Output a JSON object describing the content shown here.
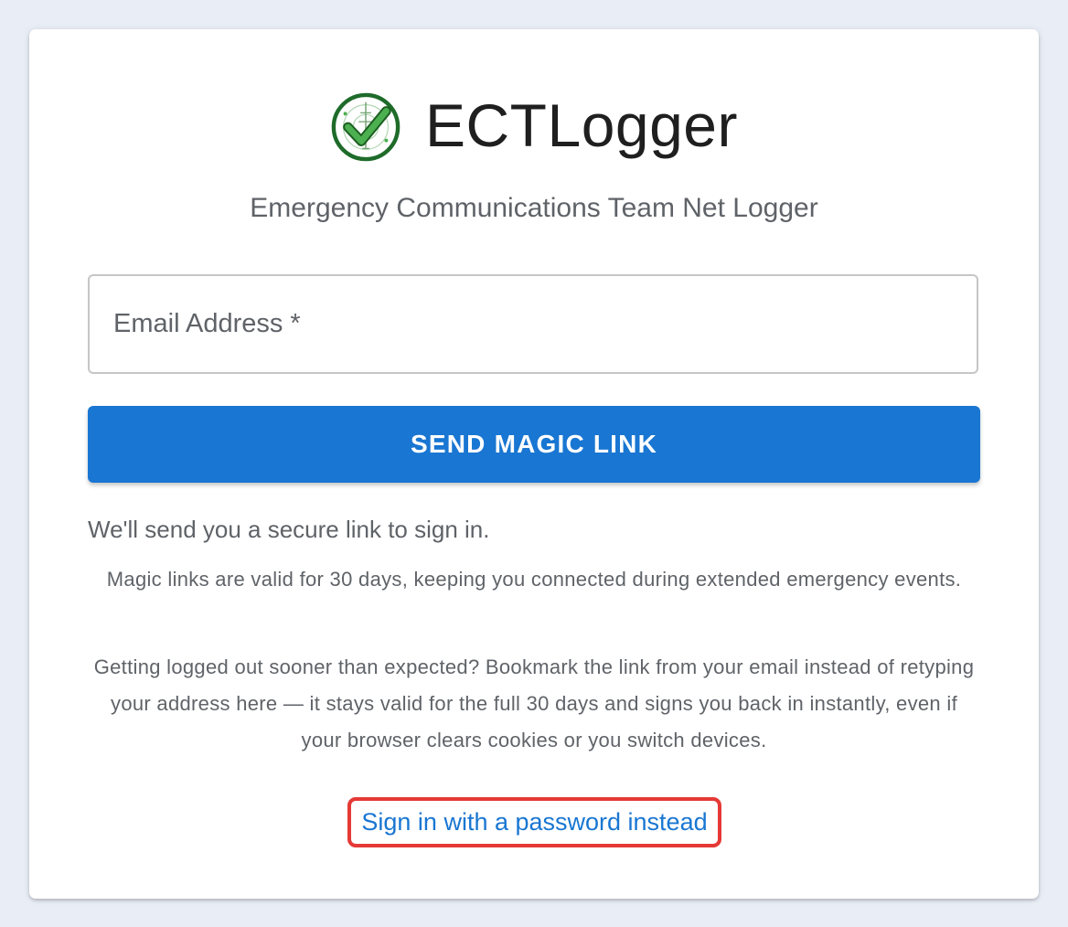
{
  "app": {
    "title": "ECTLogger",
    "subtitle": "Emergency Communications Team Net Logger",
    "logo_icon": "radio-tower-checkmark-icon"
  },
  "form": {
    "email_placeholder": "Email Address *",
    "email_value": "",
    "send_button_label": "SEND MAGIC LINK"
  },
  "info": {
    "intro": "We'll send you a secure link to sign in.",
    "validity_note": "Magic links are valid for 30 days, keeping you connected during extended emergency events.",
    "bookmark_note": "Getting logged out sooner than expected? Bookmark the link from your email instead of retyping your address here — it stays valid for the full 30 days and signs you back in instantly, even if your browser clears cookies or you switch devices."
  },
  "links": {
    "password_signin": "Sign in with a password instead"
  },
  "colors": {
    "background": "#e9edf5",
    "card": "#ffffff",
    "primary": "#1976d2",
    "logo_green": "#2e7d32",
    "highlight_border": "#e53935",
    "muted_text": "#5f6368"
  }
}
